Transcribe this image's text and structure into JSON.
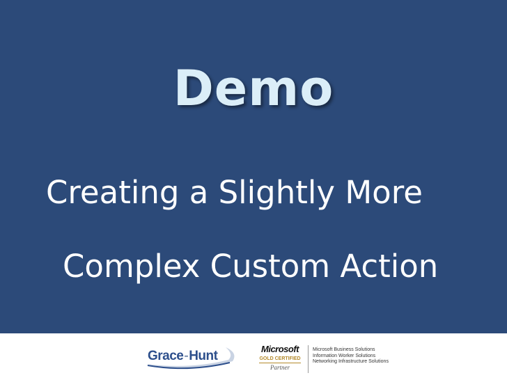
{
  "slide": {
    "title": "Demo",
    "subtitle_line1": "Creating a Slightly More",
    "subtitle_line2": "Complex Custom Action"
  },
  "footer": {
    "gracehunt_logo": {
      "part1": "Grace",
      "separator": "-",
      "part2": "Hunt"
    },
    "microsoft_logo": {
      "wordmark": "Microsoft",
      "certification": "GOLD CERTIFIED",
      "partner": "Partner"
    },
    "competencies": [
      "Microsoft Business Solutions",
      "Information Worker Solutions",
      "Networking Infrastructure Solutions"
    ]
  },
  "colors": {
    "background": "#2c4a79",
    "title": "#dbeef8",
    "subtitle": "#ffffff",
    "footer": "#ffffff",
    "gracehunt_blue": "#2d4f8c",
    "gold": "#b48a2a"
  }
}
